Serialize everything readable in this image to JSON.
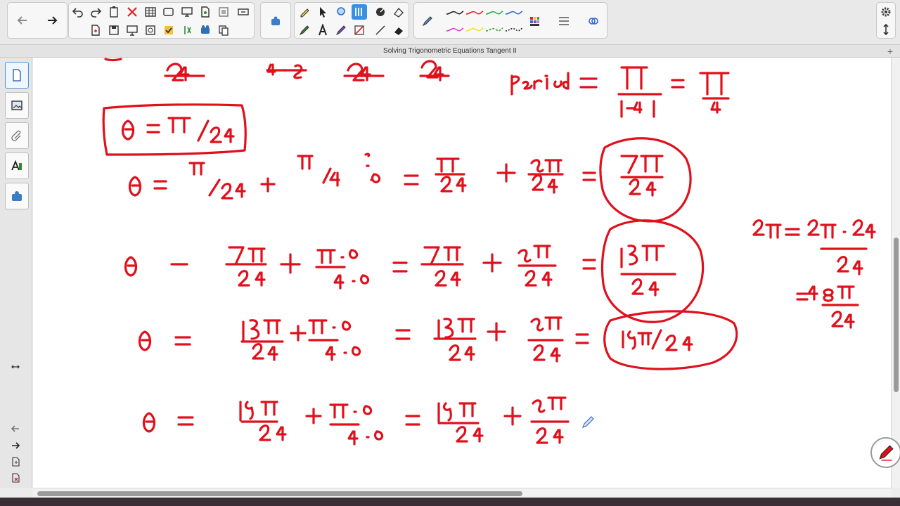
{
  "window": {
    "title": "Solving Trigonometric Equations Tangent II"
  },
  "toolbar": {
    "nav": [
      "back-arrow-icon",
      "forward-arrow-icon"
    ],
    "file_tools": [
      "undo-icon",
      "redo-icon",
      "paste-icon",
      "delete-icon",
      "table-icon",
      "screen-shade-icon",
      "display-icon",
      "document-icon",
      "gallery-icon",
      "audio-icon",
      "page-add-icon",
      "save-icon",
      "capture-icon",
      "magic-icon",
      "check-icon",
      "erase-page-icon",
      "add-ons-icon",
      "copy-icon"
    ],
    "pen_tools": [
      "highlighter-icon",
      "select-icon",
      "shapes-icon",
      "measure-icon",
      "fill-icon",
      "eraser-fill-icon",
      "pen-icon",
      "text-icon",
      "marker-icon",
      "calligraphy-icon",
      "line-icon",
      "eraser-icon"
    ],
    "accent": "#3b8fe0",
    "ink_color": "#e0101c"
  },
  "sidebar": {
    "tabs": [
      "page-sorter-icon",
      "gallery-icon",
      "attachments-icon",
      "properties-icon",
      "add-ons-icon"
    ]
  }
}
